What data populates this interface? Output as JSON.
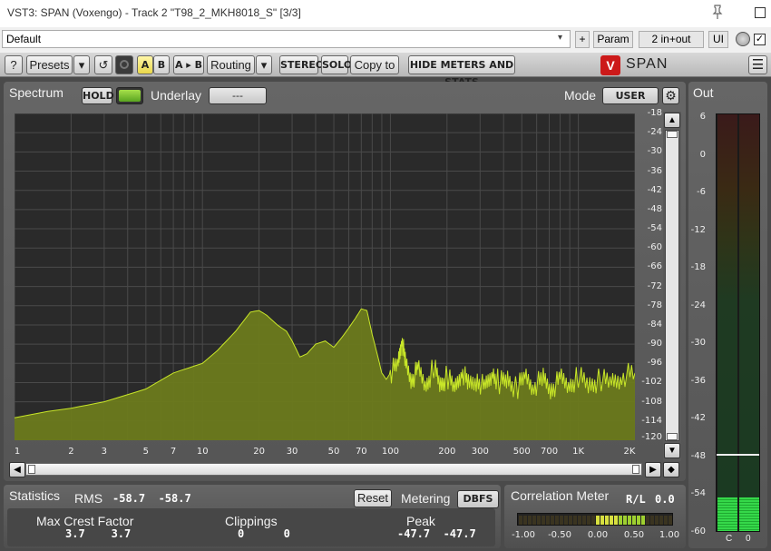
{
  "window": {
    "title": "VST3: SPAN (Voxengo) - Track 2 \"T98_2_MKH8018_S\" [3/3]",
    "preset": "Default",
    "plus_label": "+",
    "param_label": "Param",
    "routing_mode": "2 in+out",
    "ui_label": "UI",
    "bypass_checked": "✓"
  },
  "toolbar": {
    "help": "?",
    "presets": "Presets",
    "dropdown": "▾",
    "undo": "↺",
    "a": "A",
    "b": "B",
    "a_to_b": "A ▸ B",
    "routing": "Routing",
    "stereo": "STEREO",
    "solo": "SOLO",
    "copy_to": "Copy to",
    "hide_meters": "HIDE METERS AND STATS",
    "brand": "SPAN",
    "brand_mark": "V",
    "menu": "☰"
  },
  "spectrum": {
    "title": "Spectrum",
    "hold_label": "HOLD",
    "underlay_label": "Underlay",
    "underlay_value": "---",
    "mode_label": "Mode",
    "mode_value": "USER",
    "db_ticks": [
      "-18",
      "-24",
      "-30",
      "-36",
      "-42",
      "-48",
      "-54",
      "-60",
      "-66",
      "-72",
      "-78",
      "-84",
      "-90",
      "-96",
      "-102",
      "-108",
      "-114",
      "-120"
    ],
    "freq_ticks": [
      "1",
      "2",
      "3",
      "5",
      "7",
      "10",
      "20",
      "30",
      "50",
      "70",
      "100",
      "200",
      "300",
      "500",
      "700",
      "1K",
      "2K"
    ],
    "fill_color": "#6b7a1c",
    "line_color": "#c8e628"
  },
  "statistics": {
    "title": "Statistics",
    "rms_label": "RMS",
    "rms_values": "-58.7  -58.7",
    "reset_label": "Reset",
    "metering_label": "Metering",
    "metering_value": "DBFS",
    "crest_label": "Max Crest Factor",
    "crest_values": "3.7    3.7",
    "clip_label": "Clippings",
    "clip_values": "0      0",
    "peak_label": "Peak",
    "peak_values": "-47.7  -47.7"
  },
  "correlation": {
    "title": "Correlation Meter",
    "rl_label": "R/L",
    "rl_value": "0.0",
    "scale": [
      "-1.00",
      "-0.50",
      "0.00",
      "0.50",
      "1.00"
    ]
  },
  "out": {
    "title": "Out",
    "ticks": [
      "6",
      "0",
      "-6",
      "-12",
      "-18",
      "-24",
      "-30",
      "-36",
      "-42",
      "-48",
      "-54",
      "-60"
    ],
    "channels": [
      "C",
      "0"
    ],
    "level_db": -48
  }
}
